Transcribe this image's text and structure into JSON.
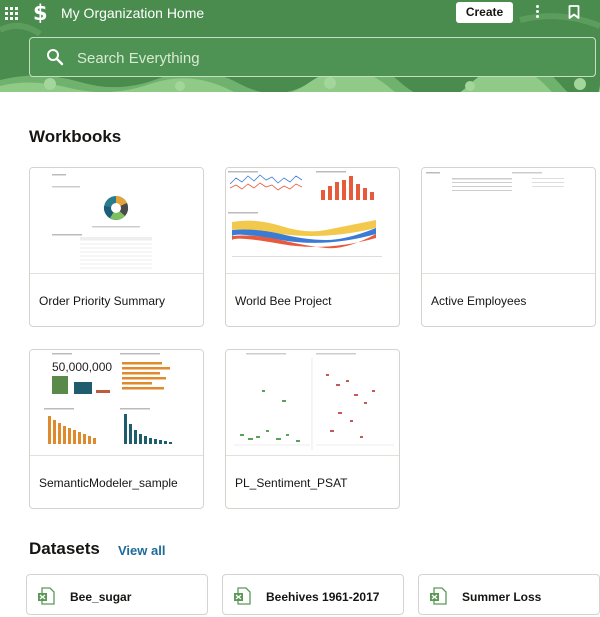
{
  "header": {
    "title": "My Organization Home",
    "create_label": "Create"
  },
  "search": {
    "placeholder": "Search Everything"
  },
  "workbooks": {
    "title": "Workbooks",
    "items": [
      {
        "label": "Order Priority Summary"
      },
      {
        "label": "World Bee Project"
      },
      {
        "label": "Active Employees"
      },
      {
        "label": "SemanticModeler_sample",
        "thumb_number": "50,000,000"
      },
      {
        "label": "PL_Sentiment_PSAT"
      }
    ]
  },
  "datasets": {
    "title": "Datasets",
    "view_all_label": "View all",
    "items": [
      {
        "label": "Bee_sugar"
      },
      {
        "label": "Beehives 1961-2017"
      },
      {
        "label": "Summer Loss"
      }
    ]
  },
  "colors": {
    "header_green": "#4a8b4e",
    "link_blue": "#1f6a9a",
    "dataset_icon_green": "#5a9a56"
  }
}
